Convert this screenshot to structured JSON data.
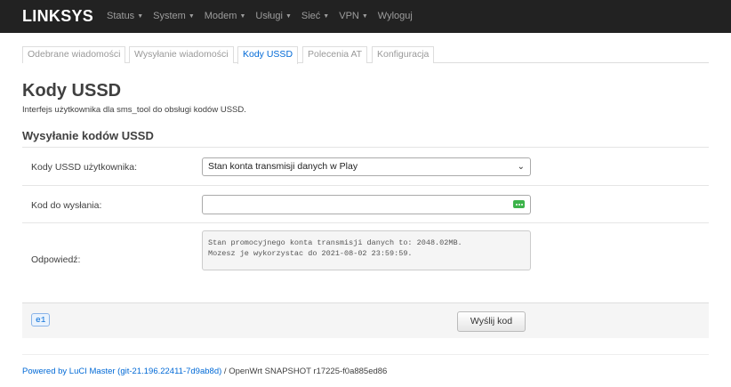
{
  "navbar": {
    "brand": "LINKSYS",
    "menu": [
      {
        "label": "Status",
        "dropdown": true
      },
      {
        "label": "System",
        "dropdown": true
      },
      {
        "label": "Modem",
        "dropdown": true
      },
      {
        "label": "Usługi",
        "dropdown": true
      },
      {
        "label": "Sieć",
        "dropdown": true
      },
      {
        "label": "VPN",
        "dropdown": true
      },
      {
        "label": "Wyloguj",
        "dropdown": false
      }
    ]
  },
  "tabs": [
    {
      "label": "Odebrane wiadomości",
      "active": false
    },
    {
      "label": "Wysyłanie wiadomości",
      "active": false
    },
    {
      "label": "Kody USSD",
      "active": true
    },
    {
      "label": "Polecenia AT",
      "active": false
    },
    {
      "label": "Konfiguracja",
      "active": false
    }
  ],
  "page": {
    "title": "Kody USSD",
    "description": "Interfejs użytkownika dla sms_tool do obsługi kodów USSD."
  },
  "section": {
    "title": "Wysyłanie kodów USSD",
    "ussd_codes_label": "Kody USSD użytkownika:",
    "ussd_codes_selected": "Stan konta transmisji danych w Play",
    "code_label": "Kod do wysłania:",
    "code_value": "",
    "response_label": "Odpowiedź:",
    "response_text": "Stan promocyjnego konta transmisji danych to: 2048.02MB.\nMozesz je wykorzystac do 2021-08-02 23:59:59."
  },
  "actions": {
    "badge": "e1",
    "submit_label": "Wyślij kod"
  },
  "footer": {
    "link_text": "Powered by LuCI Master (git-21.196.22411-7d9ab8d)",
    "rest_text": " / OpenWrt SNAPSHOT r17225-f0a885ed86"
  },
  "colors": {
    "navbar_bg": "#222222",
    "link": "#0069d6",
    "input_icon": "#3cb34a"
  }
}
